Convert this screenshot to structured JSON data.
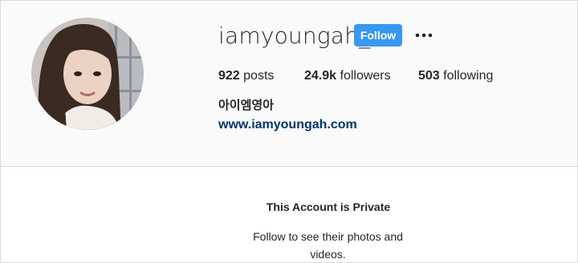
{
  "profile": {
    "username": "iamyoungah_",
    "follow_label": "Follow",
    "more_icon": "more-options-icon",
    "avatar": "profile-photo",
    "full_name": "아이엠영아",
    "website": "www.iamyoungah.com",
    "stats": {
      "posts_count": "922",
      "posts_label": " posts",
      "followers_count": "24.9k",
      "followers_label": " followers",
      "following_count": "503",
      "following_label": " following"
    }
  },
  "private_notice": {
    "title": "This Account is Private",
    "subtitle": "Follow to see their photos and videos."
  },
  "colors": {
    "accent": "#3897f0",
    "link": "#003569",
    "header_bg": "#fafafa",
    "border": "#dbdbdb",
    "text": "#262626"
  }
}
